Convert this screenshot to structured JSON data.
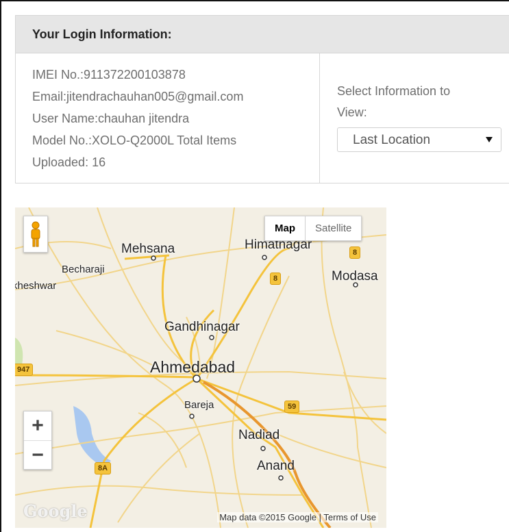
{
  "panel": {
    "heading": "Your Login Information:",
    "info_lines": [
      "IMEI No.:911372200103878",
      "Email:jitendrachauhan005@gmail.com",
      "User Name:chauhan jitendra",
      "Model No.:XOLO-Q2000L Total Items",
      "Uploaded: 16"
    ],
    "select_label_line1": "Select Information to",
    "select_label_line2": "View:",
    "select_value": "Last Location"
  },
  "map": {
    "type_map": "Map",
    "type_satellite": "Satellite",
    "zoom_in": "+",
    "zoom_out": "−",
    "attribution": "Map data ©2015 Google",
    "terms": "Terms of Use",
    "logo": "Google",
    "places": {
      "mehsana": "Mehsana",
      "himatnagar": "Himatnagar",
      "becharaji": "Becharaji",
      "kheshwar": "kheshwar",
      "modasa": "Modasa",
      "gandhinagar": "Gandhinagar",
      "ahmedabad": "Ahmedabad",
      "bareja": "Bareja",
      "nadiad": "Nadiad",
      "anand": "Anand"
    },
    "shields": {
      "s8a": "8",
      "s8b": "8",
      "s947": "947",
      "s59": "59",
      "s8a_lower": "8A"
    },
    "colors": {
      "land": "#f3efe4",
      "road": "#f4c33c",
      "highway": "#e8962e",
      "water": "#a9c8f0",
      "green": "#cfe5b0"
    }
  }
}
